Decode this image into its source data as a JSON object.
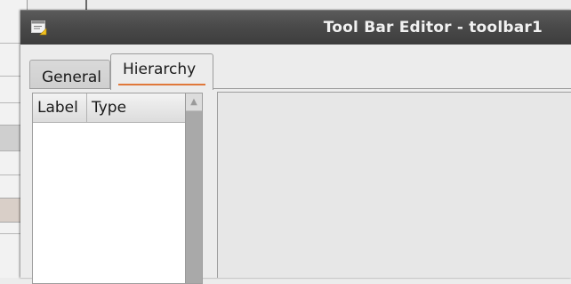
{
  "window": {
    "title": "Tool Bar Editor - toolbar1",
    "icon": "editor-window-icon"
  },
  "tabs": [
    {
      "label": "General",
      "selected": false
    },
    {
      "label": "Hierarchy",
      "selected": true
    }
  ],
  "tree": {
    "columns": [
      "Label",
      "Type"
    ],
    "rows": []
  },
  "colors": {
    "titlebar": "#4a4a4a",
    "tab_accent": "#e0783a",
    "panel": "#ececec"
  }
}
